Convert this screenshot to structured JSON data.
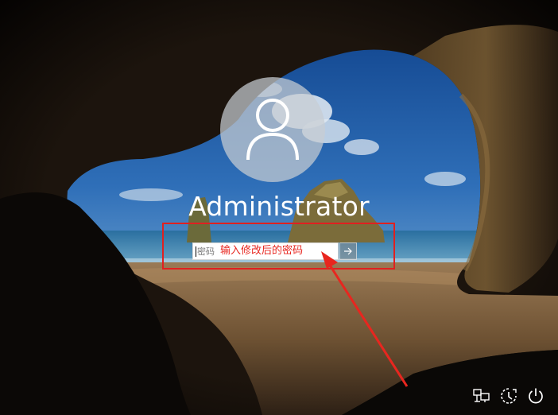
{
  "login": {
    "username": "Administrator",
    "password_placeholder": "密码",
    "annotation": "输入修改后的密码"
  },
  "icons": {
    "avatar": "user-silhouette-icon",
    "submit": "arrow-right-icon",
    "network": "network-icon",
    "ease_of_access": "ease-of-access-icon",
    "power": "power-icon"
  },
  "colors": {
    "annotation_red": "#e8261f",
    "text_white": "#ffffff"
  }
}
